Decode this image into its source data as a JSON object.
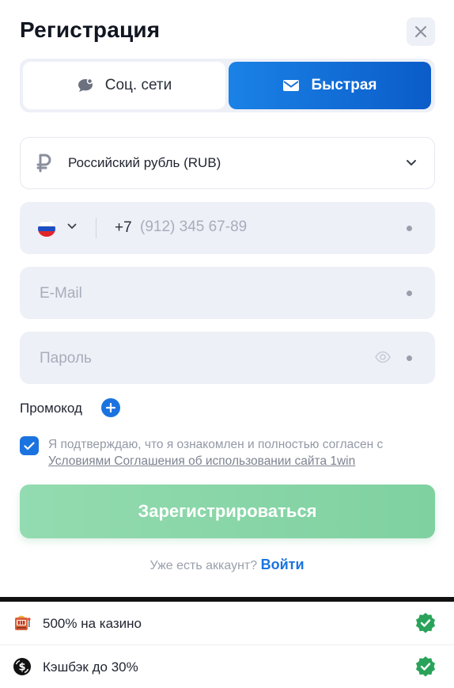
{
  "modal": {
    "title": "Регистрация"
  },
  "tabs": [
    {
      "label": "Соц. сети",
      "active": false,
      "icon": "chat-bubble-icon"
    },
    {
      "label": "Быстрая",
      "active": true,
      "icon": "envelope-icon"
    }
  ],
  "currency": {
    "label": "Российский рубль (RUB)",
    "icon": "ruble-icon"
  },
  "phone": {
    "country_flag": "russia-flag",
    "prefix": "+7",
    "placeholder": "(912) 345 67-89",
    "value": ""
  },
  "email": {
    "placeholder": "E-Mail",
    "value": ""
  },
  "password": {
    "placeholder": "Пароль",
    "value": ""
  },
  "promo": {
    "label": "Промокод"
  },
  "agreement": {
    "checked": true,
    "text": "Я подтверждаю, что я ознакомлен и полностью согласен с",
    "link": "Условиями Соглашения об использовании сайта 1win"
  },
  "register_button": {
    "label": "Зарегистрироваться"
  },
  "login": {
    "prompt": "Уже есть аккаунт?",
    "link": "Войти"
  },
  "bonuses": [
    {
      "text": "500% на казино",
      "icon": "slot-machine-icon"
    },
    {
      "text": "Кэшбэк до 30%",
      "icon": "cashback-icon"
    }
  ],
  "colors": {
    "accent": "#1b73e0",
    "register_button": "#8fd8ac",
    "field_bg": "#eef0f7",
    "badge_green": "#2aa35a"
  }
}
